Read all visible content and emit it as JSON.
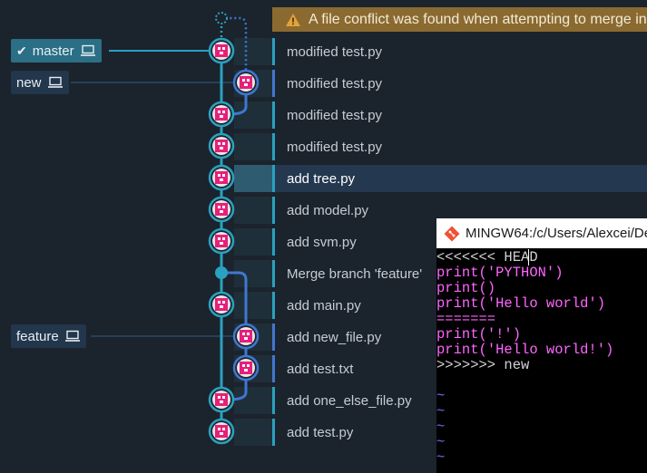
{
  "warning": {
    "text": "A file conflict was found when attempting to merge in"
  },
  "branches": [
    {
      "name": "master",
      "active": true
    },
    {
      "name": "new",
      "active": false
    },
    {
      "name": "feature",
      "active": false
    }
  ],
  "commits": [
    {
      "message": "modified test.py",
      "selected": false
    },
    {
      "message": "modified test.py",
      "selected": false
    },
    {
      "message": "modified test.py",
      "selected": false
    },
    {
      "message": "modified test.py",
      "selected": false
    },
    {
      "message": "add tree.py",
      "selected": true
    },
    {
      "message": "add model.py",
      "selected": false
    },
    {
      "message": "add svm.py",
      "selected": false
    },
    {
      "message": "Merge branch 'feature'",
      "selected": false
    },
    {
      "message": "add main.py",
      "selected": false
    },
    {
      "message": "add new_file.py",
      "selected": false
    },
    {
      "message": "add test.txt",
      "selected": false
    },
    {
      "message": "add one_else_file.py",
      "selected": false
    },
    {
      "message": "add test.py",
      "selected": false
    }
  ],
  "terminal": {
    "title": "MINGW64:/c/Users/Alexcei/De",
    "lines": [
      {
        "pre": "<<<<<<< HEA",
        "cursor": "D",
        "post": "",
        "style": "white"
      },
      {
        "pre": "print(",
        "str": "'PYTHON'",
        "post": ")",
        "style": "magenta"
      },
      {
        "pre": "print()",
        "str": "",
        "post": "",
        "style": "magenta"
      },
      {
        "pre": "print(",
        "str": "'Hello world'",
        "post": ")",
        "style": "magenta"
      },
      {
        "pre": "=======",
        "str": "",
        "post": "",
        "style": "magenta"
      },
      {
        "pre": "print(",
        "str": "'!'",
        "post": ")",
        "style": "magenta"
      },
      {
        "pre": "print(",
        "str": "'Hello world!'",
        "post": ")",
        "style": "magenta"
      },
      {
        "pre": ">>>>>>> new",
        "str": "",
        "post": "",
        "style": "white"
      },
      {
        "pre": "",
        "str": "",
        "post": "",
        "style": "white"
      },
      {
        "pre": "~",
        "str": "",
        "post": "",
        "style": "tilde"
      },
      {
        "pre": "~",
        "str": "",
        "post": "",
        "style": "tilde"
      },
      {
        "pre": "~",
        "str": "",
        "post": "",
        "style": "tilde"
      },
      {
        "pre": "~",
        "str": "",
        "post": "",
        "style": "tilde"
      },
      {
        "pre": "~",
        "str": "",
        "post": "",
        "style": "tilde"
      }
    ]
  },
  "colors": {
    "mainline": "#2aa1c0",
    "branchline": "#3f78d1",
    "node_ring": "#2aa1c0",
    "avatar": "#e6207a"
  }
}
